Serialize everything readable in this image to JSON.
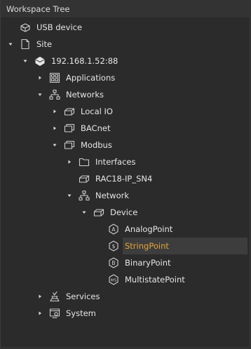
{
  "panel": {
    "title": "Workspace Tree"
  },
  "colors": {
    "background": "#2b2b2b",
    "selected_text": "#e8a33a",
    "text": "#e6e6e6"
  },
  "tree": [
    {
      "label": "USB device",
      "icon": "usb-device-icon",
      "expander": "none",
      "selected": false
    },
    {
      "label": "Site",
      "icon": "document-icon",
      "expander": "expanded",
      "selected": false
    },
    {
      "label": "192.168.1.52:88",
      "icon": "server-icon",
      "expander": "expanded",
      "selected": false
    },
    {
      "label": "Applications",
      "icon": "applications-icon",
      "expander": "collapsed",
      "selected": false
    },
    {
      "label": "Networks",
      "icon": "network-icon",
      "expander": "expanded",
      "selected": false
    },
    {
      "label": "Local IO",
      "icon": "device-icon",
      "expander": "collapsed",
      "selected": false
    },
    {
      "label": "BACnet",
      "icon": "protocol-icon",
      "expander": "collapsed",
      "selected": false
    },
    {
      "label": "Modbus",
      "icon": "protocol-icon",
      "expander": "expanded",
      "selected": false
    },
    {
      "label": "Interfaces",
      "icon": "folder-icon",
      "expander": "collapsed",
      "selected": false
    },
    {
      "label": "RAC18-IP_SN4",
      "icon": "device-icon",
      "expander": "none",
      "selected": false
    },
    {
      "label": "Network",
      "icon": "network-icon",
      "expander": "expanded",
      "selected": false
    },
    {
      "label": "Device",
      "icon": "device-icon",
      "expander": "expanded",
      "selected": false
    },
    {
      "label": "AnalogPoint",
      "icon": "analog-point-icon",
      "expander": "none",
      "selected": false
    },
    {
      "label": "StringPoint",
      "icon": "string-point-icon",
      "expander": "none",
      "selected": true
    },
    {
      "label": "BinaryPoint",
      "icon": "binary-point-icon",
      "expander": "none",
      "selected": false
    },
    {
      "label": "MultistatePoint",
      "icon": "multistate-point-icon",
      "expander": "none",
      "selected": false
    },
    {
      "label": "Services",
      "icon": "services-icon",
      "expander": "collapsed",
      "selected": false
    },
    {
      "label": "System",
      "icon": "system-icon",
      "expander": "collapsed",
      "selected": false
    }
  ]
}
